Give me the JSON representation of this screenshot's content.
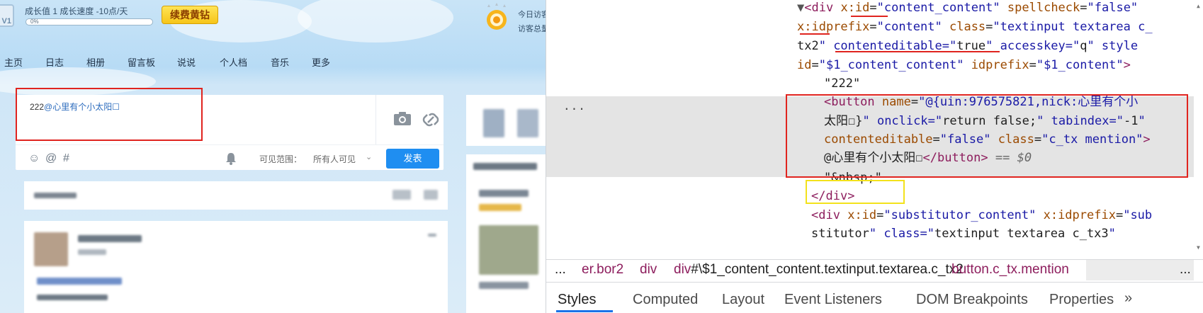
{
  "qzone": {
    "level_badge": "V1",
    "growth_text": "成长值 1   成长速度 -10点/天",
    "progress_label": "0%",
    "progress_value": 0,
    "vip_button": "续费黄钻",
    "visit_today": "今日访客",
    "visit_total": "访客总量",
    "nav": [
      "主页",
      "日志",
      "相册",
      "留言板",
      "说说",
      "个人档",
      "音乐",
      "更多"
    ],
    "publisher": {
      "text_prefix": "222",
      "mention": "@心里有个小太阳☐",
      "tool_icons": [
        "emoji-icon",
        "at-icon",
        "hashtag-icon"
      ],
      "scope_label": "可见范围：",
      "scope_value": "所有人可见",
      "publish_button": "发表"
    }
  },
  "devtools": {
    "lines": [
      {
        "t": "▼<div x:id=\"content_content\" spellcheck=\"false\""
      },
      {
        "t": "x:idprefix=\"content\" class=\"textinput textarea c_"
      },
      {
        "t": "tx2\" contenteditable=\"true\" accesskey=\"q\" style"
      },
      {
        "t": "id=\"$1_content_content\" idprefix=\"$1_content\">"
      },
      {
        "t": "\"222\""
      },
      {
        "t": "<button name=\"@{uin:976575821,nick:心里有个小"
      },
      {
        "t": "太阳☐}\" onclick=\"return false;\" tabindex=\"-1\""
      },
      {
        "t": "contenteditable=\"false\" class=\"c_tx mention\">"
      },
      {
        "t": "@心里有个小太阳☐</button> == $0"
      },
      {
        "t": "\"&nbsp;\""
      },
      {
        "t": "</div>"
      },
      {
        "t": "<div x:id=\"substitutor_content\" x:idprefix=\"sub"
      },
      {
        "t": "stitutor\" class=\"textinput textarea c_tx3\""
      }
    ],
    "breadcrumbs": [
      "...",
      "er.bor2",
      "div",
      "div#\\$1_content_content.textinput.textarea.c_tx2",
      "button.c_tx.mention",
      "..."
    ],
    "tabs": [
      "Styles",
      "Computed",
      "Layout",
      "Event Listeners",
      "DOM Breakpoints",
      "Properties",
      "»"
    ],
    "active_tab": "Styles",
    "ellipsis": "..."
  },
  "colors": {
    "publish_blue": "#1f8ef1",
    "highlight_red": "#e0241f",
    "highlight_yellow": "#f3e21c",
    "tag_color": "#8d1d5d",
    "attr_name": "#9b4a00",
    "attr_value": "#1a1aa6"
  }
}
